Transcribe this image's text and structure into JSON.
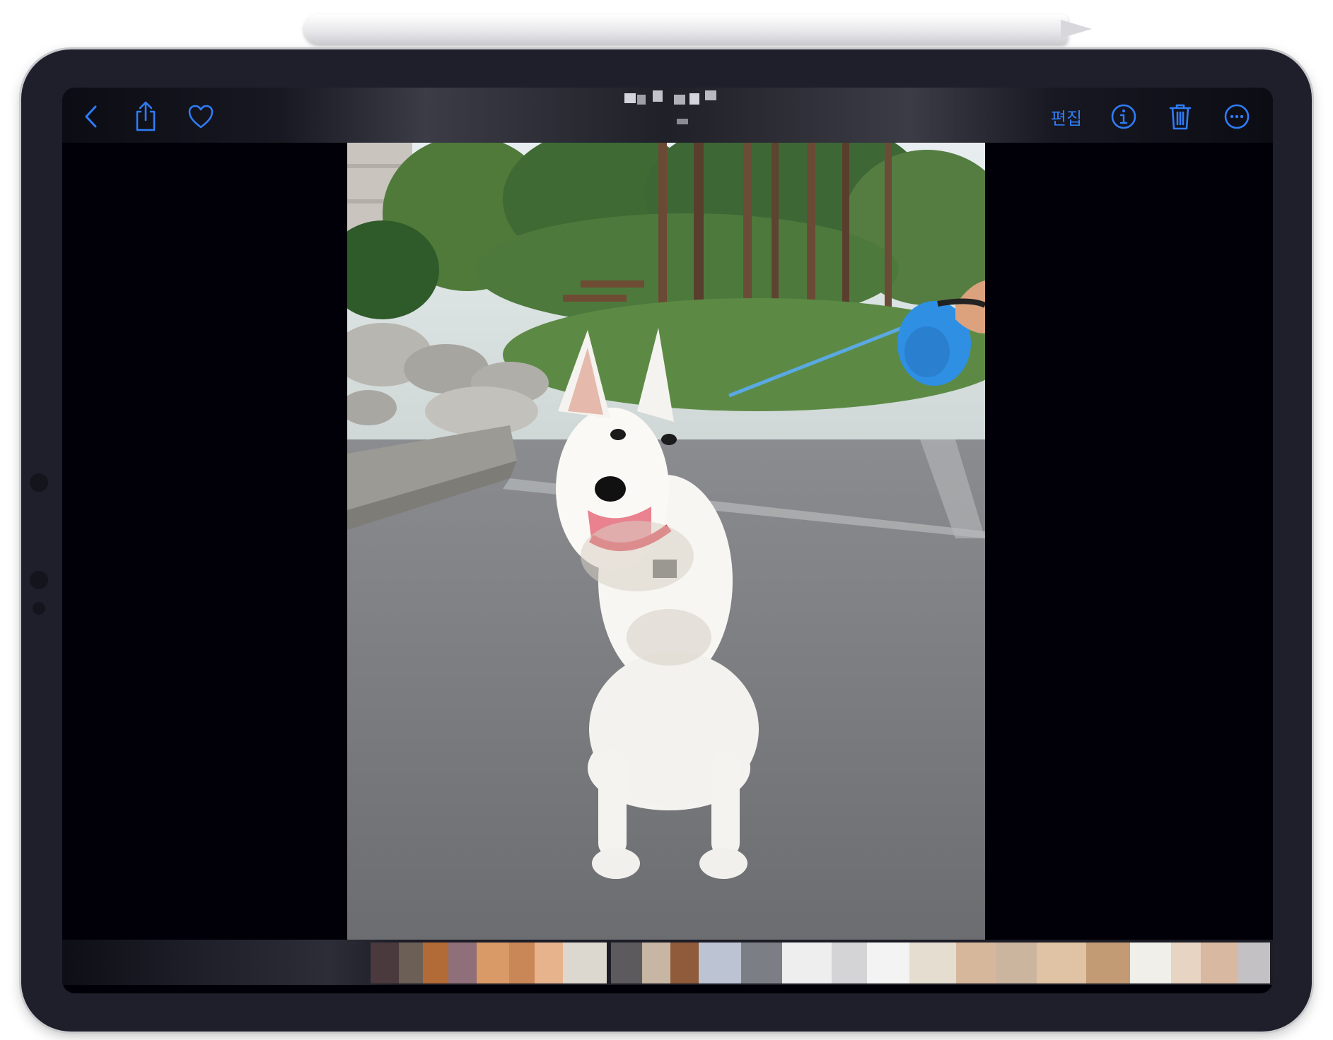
{
  "toolbar": {
    "back_icon": "chevron-left-icon",
    "share_icon": "share-icon",
    "favorite_icon": "heart-icon",
    "edit_label": "편집",
    "info_icon": "info-icon",
    "delete_icon": "trash-icon",
    "more_icon": "ellipsis-circle-icon"
  },
  "colors": {
    "accent": "#2f7cf6",
    "background": "#010008"
  }
}
